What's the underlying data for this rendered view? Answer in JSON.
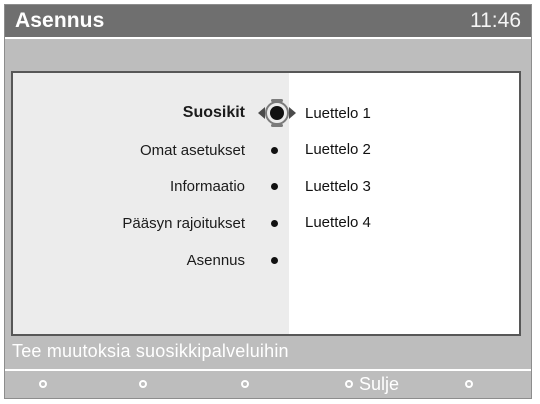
{
  "header": {
    "title": "Asennus",
    "clock": "11:46"
  },
  "menu": {
    "items": [
      {
        "label": "Suosikit",
        "selected": true
      },
      {
        "label": "Omat asetukset",
        "selected": false
      },
      {
        "label": "Informaatio",
        "selected": false
      },
      {
        "label": "Pääsyn rajoitukset",
        "selected": false
      },
      {
        "label": "Asennus",
        "selected": false
      }
    ]
  },
  "submenu": {
    "items": [
      "Luettelo 1",
      "Luettelo 2",
      "Luettelo 3",
      "Luettelo 4"
    ]
  },
  "help": {
    "text": "Tee muutoksia suosikkipalveluihin"
  },
  "buttons": [
    {
      "label": ""
    },
    {
      "label": ""
    },
    {
      "label": ""
    },
    {
      "label": "Sulje"
    },
    {
      "label": ""
    }
  ],
  "icons": {
    "navigation": "dpad-icon",
    "bullet": "bullet-icon",
    "button_marker": "button-dot-icon"
  },
  "colors": {
    "header_background": "#6f6f6f",
    "frame_background": "#bdbdbd",
    "left_pane": "#ececec",
    "right_pane": "#ffffff",
    "text": "#1b1b1b"
  }
}
